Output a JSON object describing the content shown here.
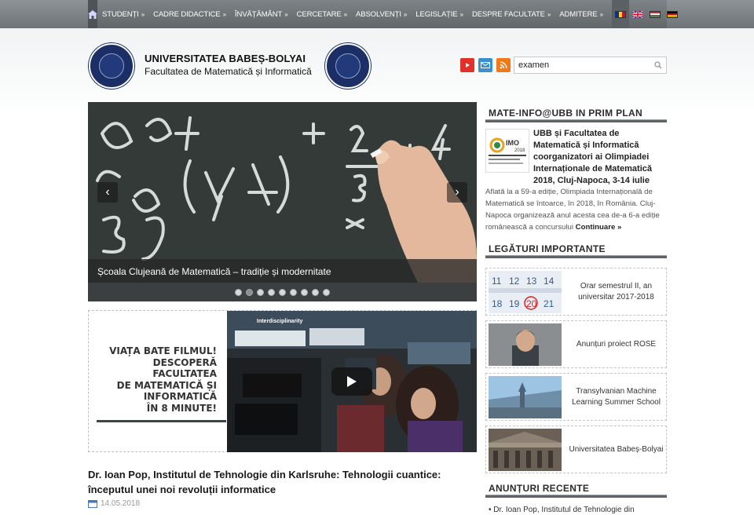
{
  "nav": {
    "items": [
      "STUDENȚI",
      "CADRE DIDACTICE",
      "ÎNVĂȚĂMÂNT",
      "CERCETARE",
      "ABSOLVENȚI",
      "LEGISLAȚIE",
      "DESPRE FACULTATE",
      "ADMITERE"
    ],
    "chevron": "»",
    "home_icon": "home-icon",
    "flags": [
      "ro",
      "en",
      "hu",
      "de"
    ]
  },
  "header": {
    "university": "UNIVERSITATEA BABEȘ-BOLYAI",
    "faculty": "Facultatea de Matematică și Informatică",
    "social": [
      "youtube-icon",
      "email-icon",
      "rss-icon"
    ],
    "search_value": "examen"
  },
  "slider": {
    "caption": "Școala Clujeană de Matematică – tradiție și modernitate",
    "dots": 9,
    "active_dot": 1,
    "prev": "‹",
    "next": "›"
  },
  "video_box": {
    "lines": [
      "VIAȚA BATE FILMUL!",
      "DESCOPERĂ",
      "FACULTATEA",
      "DE MATEMATICĂ ȘI",
      "INFORMATICĂ",
      "ÎN 8 MINUTE!"
    ],
    "video_label": "Interdisciplinarity"
  },
  "article": {
    "title": "Dr. Ioan Pop, Institutul de Tehnologie din Karlsruhe: Tehnologii cuantice: începutul unei noi revoluții informatice",
    "date": "14.05.2018"
  },
  "sidebar": {
    "featured_heading": "MATE-INFO@UBB IN PRIM PLAN",
    "featured_title": "UBB și Facultatea de Matematică și Informatică coorganizatori ai Olimpiadei Internaționale de Matematică 2018, Cluj-Napoca, 3-14 iulie",
    "featured_text": "Aflată la a 59-a ediție, Olimpiada Internațională de Matematică se întoarce, în 2018, în România. Cluj-Napoca organizează anul acesta cea de-a 6-a ediție românească a concursului",
    "featured_more": "Continuare »",
    "links_heading": "LEGĂTURI IMPORTANTE",
    "links": [
      "Orar semestrul II, an universitar 2017-2018",
      "Anunțuri proiect ROSE",
      "Transylvanian Machine Learning Summer School",
      "Universitatea Babeș-Bolyai"
    ],
    "news_heading": "ANUNȚURI RECENTE",
    "news_first": "Dr. Ioan Pop, Institutul de Tehnologie din"
  },
  "colors": {
    "nav_bg": "#6e7478",
    "heading_bar": "#5c6466",
    "logo_blue": "#1b2f66",
    "youtube": "#e0312b",
    "email": "#3a8fd0",
    "rss": "#f07a1a"
  }
}
